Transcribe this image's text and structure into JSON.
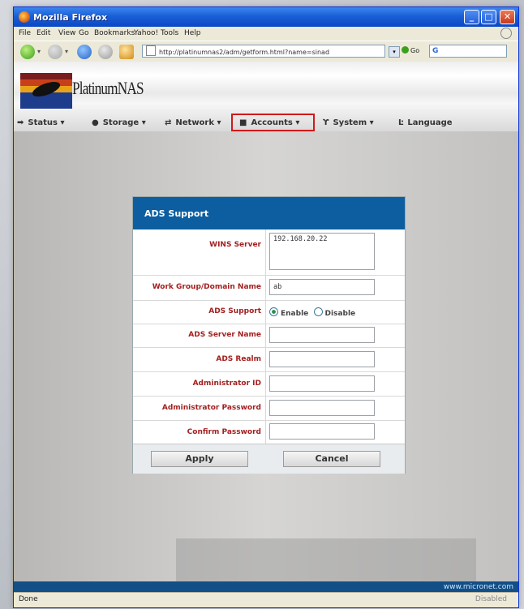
{
  "window": {
    "title": "Mozilla Firefox"
  },
  "menubar": [
    "File",
    "Edit",
    "View",
    "Go",
    "Bookmarks",
    "Yahoo!",
    "Tools",
    "Help"
  ],
  "navbar": {
    "url": "http://platinumnas2/adm/getform.html?name=sinad",
    "go_label": "Go",
    "search_placeholder": "G"
  },
  "brand": {
    "logo_text": "PlatinumNAS"
  },
  "nav_menu": [
    {
      "label": "Status",
      "icon": "status-arrow-icon"
    },
    {
      "label": "Storage",
      "icon": "storage-disk-icon"
    },
    {
      "label": "Network",
      "icon": "network-icon"
    },
    {
      "label": "Accounts",
      "icon": "accounts-icon"
    },
    {
      "label": "System",
      "icon": "system-icon"
    },
    {
      "label": "Language",
      "icon": "language-icon"
    }
  ],
  "ads_form": {
    "title": "ADS Support",
    "wins_server": {
      "label": "WINS Server",
      "value": "192.168.20.22"
    },
    "workgroup": {
      "label": "Work Group/Domain Name",
      "value": "ab"
    },
    "ads_support": {
      "label": "ADS Support",
      "enable_label": "Enable",
      "disable_label": "Disable",
      "selected": "Enable"
    },
    "ads_server_name": {
      "label": "ADS Server Name",
      "value": ""
    },
    "ads_realm": {
      "label": "ADS Realm",
      "value": ""
    },
    "admin_id": {
      "label": "Administrator ID",
      "value": ""
    },
    "admin_password": {
      "label": "Administrator Password",
      "value": ""
    },
    "confirm_password": {
      "label": "Confirm Password",
      "value": ""
    },
    "apply_label": "Apply",
    "cancel_label": "Cancel"
  },
  "footer": {
    "text": "www.micronet.com"
  },
  "statusbar": {
    "text": "Done",
    "right": "Disabled"
  },
  "colors": {
    "accent": "#0c5ea0",
    "label_red": "#a32020",
    "highlight": "#d01a1a"
  }
}
